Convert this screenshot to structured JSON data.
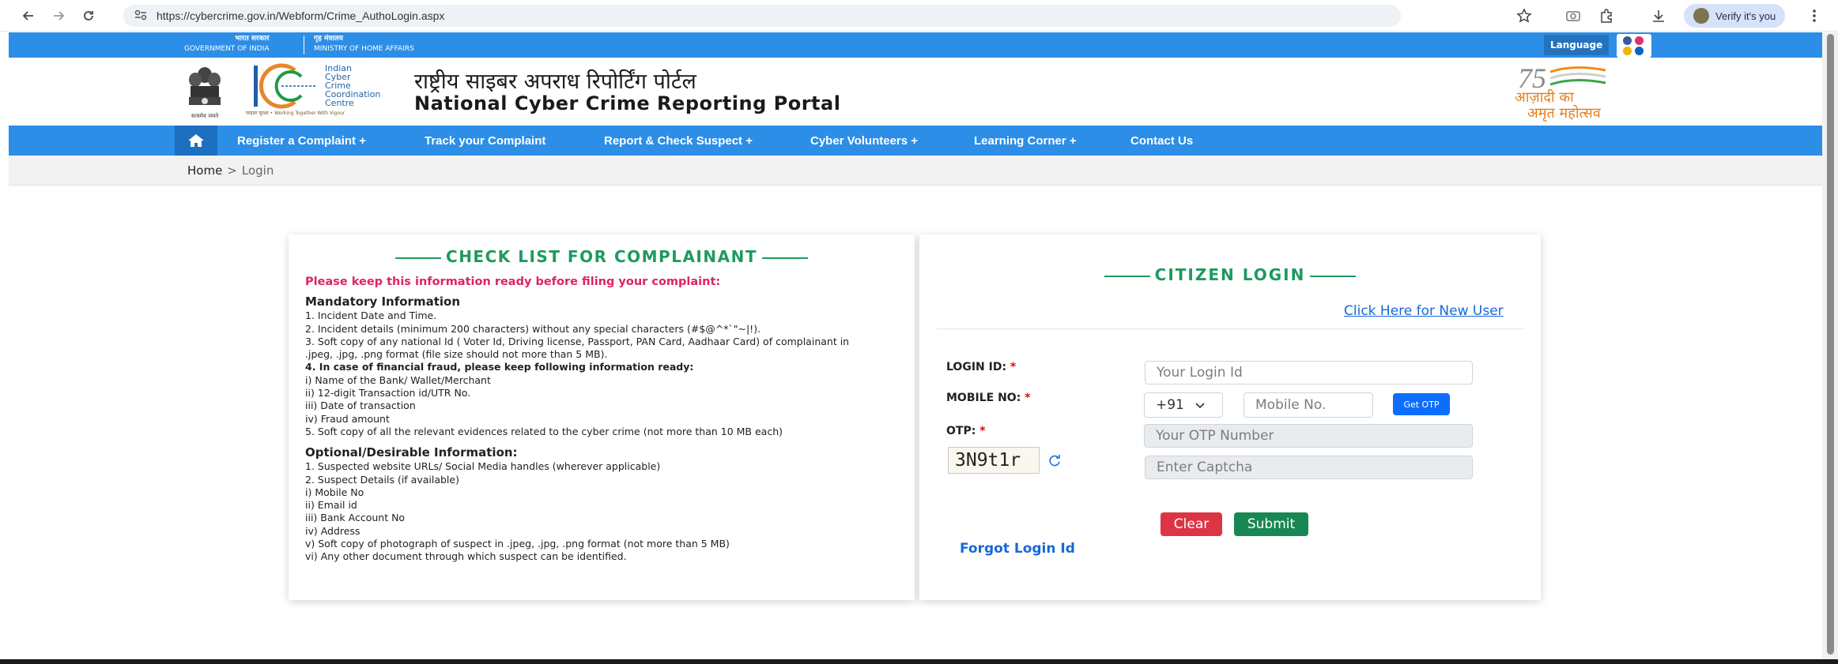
{
  "browser": {
    "url": "https://cybercrime.gov.in/Webform/Crime_AuthoLogin.aspx",
    "verify_label": "Verify it's you"
  },
  "gov_strip": {
    "gov_hi": "भारत सरकार",
    "gov_en": "GOVERNMENT OF INDIA",
    "ministry_hi": "गृह मंत्रालय",
    "ministry_en": "MINISTRY OF HOME AFFAIRS",
    "language_label": "Language"
  },
  "header": {
    "icc_lines": [
      "Indian",
      "Cyber",
      "Crime",
      "Coordination",
      "Centre"
    ],
    "icc_tagline": "साइबर सुरक्षा • Working Together With Vigour",
    "emblem_caption": "सत्यमेव जयते",
    "title_hindi": "राष्ट्रीय साइबर अपराध रिपोर्टिंग पोर्टल",
    "title_english": "National Cyber Crime Reporting Portal",
    "azadi_line1": "आज़ादी का",
    "azadi_line2": "अमृत महोत्सव"
  },
  "nav": {
    "items": [
      {
        "label": "Register a Complaint +"
      },
      {
        "label": "Track your Complaint"
      },
      {
        "label": "Report & Check Suspect +"
      },
      {
        "label": "Cyber Volunteers +"
      },
      {
        "label": "Learning Corner +"
      },
      {
        "label": "Contact Us"
      }
    ]
  },
  "breadcrumb": {
    "home": "Home",
    "separator": ">",
    "current": "Login"
  },
  "checklist": {
    "title": "CHECK LIST FOR COMPLAINANT",
    "warning": "Please keep this information ready before filing your complaint:",
    "mandatory_heading": "Mandatory Information",
    "mandatory_items": [
      "1. Incident Date and Time.",
      "2. Incident details (minimum 200 characters) without any special characters (#$@^*`\"~|!).",
      "3. Soft copy of any national Id ( Voter Id, Driving license, Passport, PAN Card, Aadhaar Card) of complainant in .jpeg, .jpg, .png format (file size should not more than 5 MB)."
    ],
    "financial_heading": "4. In case of financial fraud, please keep following information ready:",
    "financial_items": [
      "i) Name of the Bank/ Wallet/Merchant",
      "ii) 12-digit Transaction id/UTR No.",
      "iii) Date of transaction",
      "iv) Fraud amount",
      "5. Soft copy of all the relevant evidences related to the cyber crime (not more than 10 MB each)"
    ],
    "optional_heading": "Optional/Desirable Information:",
    "optional_items": [
      "1. Suspected website URLs/ Social Media handles (wherever applicable)",
      "2. Suspect Details (if available)",
      "i) Mobile No",
      "ii) Email id",
      "iii) Bank Account No",
      "iv) Address",
      "v) Soft copy of photograph of suspect in .jpeg, .jpg, .png format (not more than 5 MB)",
      "vi) Any other document through which suspect can be identified."
    ]
  },
  "login": {
    "title": "CITIZEN LOGIN",
    "new_user_link": "Click Here for New User",
    "login_id_label": "LOGIN ID:",
    "login_id_placeholder": "Your Login Id",
    "mobile_label": "MOBILE NO:",
    "country_code": "+91",
    "mobile_placeholder": "Mobile No.",
    "get_otp_label": "Get OTP",
    "otp_label": "OTP:",
    "otp_placeholder": "Your OTP Number",
    "captcha_text": "3N9t1r",
    "captcha_placeholder": "Enter Captcha",
    "clear_label": "Clear",
    "submit_label": "Submit",
    "forgot_link": "Forgot Login Id",
    "required_mark": "*"
  },
  "colors": {
    "nav_blue": "#2c8ee6",
    "green": "#1e9a5f",
    "warning_pink": "#e0245e",
    "link_blue": "#1768d6"
  }
}
